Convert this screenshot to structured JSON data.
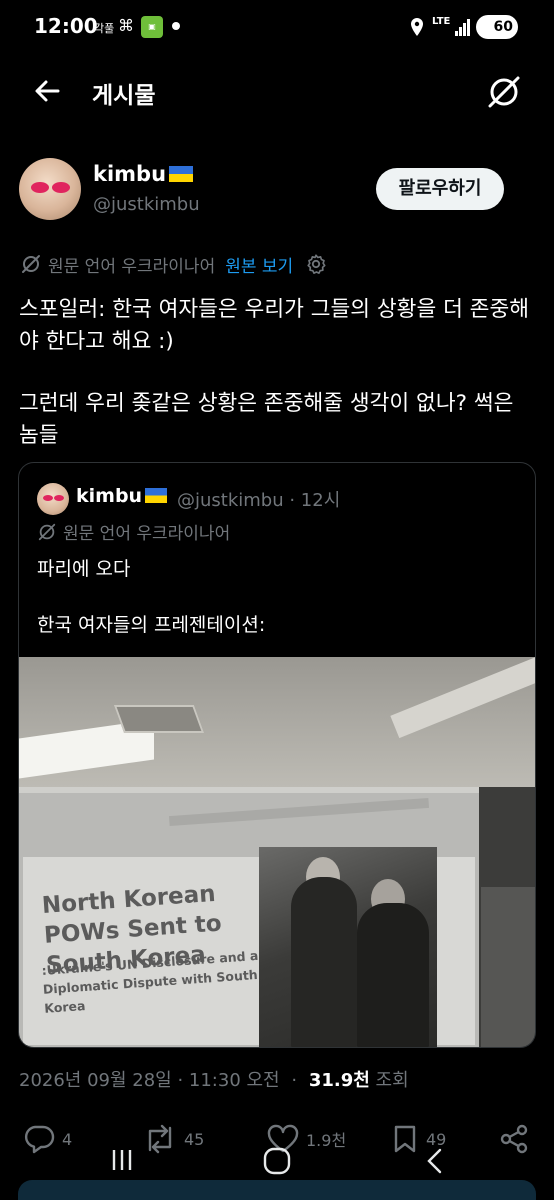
{
  "status_bar": {
    "time": "12:00",
    "carrier_label": "각풀",
    "network": "LTE",
    "battery": "60"
  },
  "topbar": {
    "title": "게시물",
    "back_icon": "arrow-left-icon",
    "grok_icon": "grok-icon"
  },
  "author": {
    "display_name": "kimbu",
    "flag": "ukraine-flag",
    "handle": "@justkimbu",
    "follow_label": "팔로우하기"
  },
  "translation": {
    "label": "원문 언어 우크라이나어",
    "view_original": "원본 보기"
  },
  "tweet": {
    "paragraph1": "스포일러: 한국 여자들은 우리가 그들의 상황을 더 존중해야 한다고 해요 :)",
    "paragraph2": "그런데 우리 좆같은 상황은 존중해줄 생각이 없나? 썩은 놈들"
  },
  "quote": {
    "display_name": "kimbu",
    "handle_time": "@justkimbu · 12시",
    "translation_label": "원문 언어 우크라이나어",
    "text1": "파리에 오다",
    "text2": "한국 여자들의 프레젠테이션:",
    "image": {
      "slide_title": "North Korean POWs Sent to South Korea",
      "slide_subtitle": ":Ukraine's UN Disclosure and a Diplomatic Dispute with South Korea"
    }
  },
  "meta": {
    "datetime": "2026년 09월 28일 · 11:30 오전",
    "separator": "·",
    "views_count": "31.9천",
    "views_label": "조회"
  },
  "actions": {
    "replies": "4",
    "reposts": "45",
    "likes": "1.9천",
    "bookmarks": "49"
  },
  "colors": {
    "accent": "#1d9bf0",
    "secondary_text": "#71767b",
    "background": "#000000"
  }
}
